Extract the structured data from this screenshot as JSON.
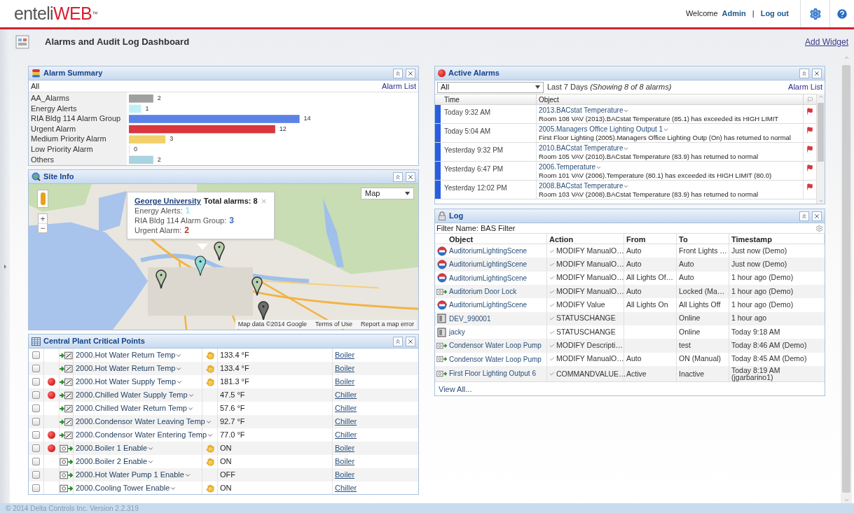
{
  "header": {
    "logo_main": "enteli",
    "logo_accent": "WEB",
    "logo_tm": "™",
    "welcome": "Welcome",
    "user": "Admin",
    "separator": "|",
    "logout": "Log out"
  },
  "page": {
    "title": "Alarms and Audit Log Dashboard",
    "add_widget": "Add Widget"
  },
  "alarm_summary": {
    "title": "Alarm Summary",
    "filter": "All",
    "link": "Alarm List",
    "chart_data": {
      "type": "bar",
      "orientation": "horizontal",
      "categories": [
        "AA_Alarms",
        "Energy Alerts",
        "RIA Bldg 114 Alarm Group",
        "Urgent Alarm",
        "Medium Priority Alarm",
        "Low Priority Alarm",
        "Others"
      ],
      "values": [
        2,
        1,
        14,
        12,
        3,
        0,
        2
      ],
      "colors": [
        "#a0a0a0",
        "#bff0f8",
        "#5b82e6",
        "#d9363e",
        "#f2d16b",
        "#dddddd",
        "#a9d3df"
      ],
      "data_labels": true
    }
  },
  "site_info": {
    "title": "Site Info",
    "map_type": "Map",
    "zoom_in": "+",
    "zoom_out": "−",
    "popup": {
      "site": "George University",
      "total": "Total alarms: 8",
      "lines": [
        {
          "label": "Energy Alerts:",
          "count": "1",
          "color": "#9ee3f0"
        },
        {
          "label": "RIA Bldg 114 Alarm Group:",
          "count": "3",
          "color": "#3b6fb6"
        },
        {
          "label": "Urgent Alarm:",
          "count": "2",
          "color": "#c0392b"
        }
      ]
    },
    "markers": [
      {
        "color": "#8fdada",
        "selected": true
      },
      {
        "color": "#b9cfae",
        "selected": false
      },
      {
        "color": "#b9cfae",
        "selected": false
      },
      {
        "color": "#b9cfae",
        "selected": false
      },
      {
        "color": "#6e6e6e",
        "selected": false
      }
    ],
    "attribution": "Map data ©2014 Google",
    "terms": "Terms of Use",
    "report": "Report a map error"
  },
  "central_plant": {
    "title": "Central Plant Critical Points",
    "rows": [
      {
        "checked": false,
        "alarm": false,
        "kind": "analog",
        "name": "2000.Hot Water Return Temp",
        "override": true,
        "value": "133.4 °F",
        "link": "Boiler"
      },
      {
        "checked": false,
        "alarm": false,
        "kind": "analog",
        "name": "2000.Hot Water Return Temp",
        "override": true,
        "value": "133.4 °F",
        "link": "Boiler"
      },
      {
        "checked": false,
        "alarm": true,
        "kind": "analog",
        "name": "2000.Hot Water Supply Temp",
        "override": true,
        "value": "181.3 °F",
        "link": "Boiler"
      },
      {
        "checked": false,
        "alarm": true,
        "kind": "analog",
        "name": "2000.Chilled Water Supply Temp",
        "override": false,
        "value": "47.5 °F",
        "link": "Chiller"
      },
      {
        "checked": false,
        "alarm": false,
        "kind": "analog",
        "name": "2000.Chilled Water Return Temp",
        "override": false,
        "value": "57.6 °F",
        "link": "Chiller"
      },
      {
        "checked": false,
        "alarm": false,
        "kind": "analog",
        "name": "2000.Condensor Water Leaving Temp",
        "override": false,
        "value": "92.7 °F",
        "link": "Chiller"
      },
      {
        "checked": false,
        "alarm": true,
        "kind": "analog",
        "name": "2000.Condensor Water Entering Temp",
        "override": false,
        "value": "77.0 °F",
        "link": "Chiller"
      },
      {
        "checked": false,
        "alarm": true,
        "kind": "binary",
        "name": "2000.Boiler 1 Enable",
        "override": true,
        "value": "ON",
        "link": "Boiler"
      },
      {
        "checked": false,
        "alarm": false,
        "kind": "binary",
        "name": "2000.Boiler 2 Enable",
        "override": true,
        "value": "ON",
        "link": "Boiler"
      },
      {
        "checked": false,
        "alarm": false,
        "kind": "binary",
        "name": "2000.Hot Water Pump 1 Enable",
        "override": false,
        "value": "OFF",
        "link": "Boiler"
      },
      {
        "checked": false,
        "alarm": false,
        "kind": "binary",
        "name": "2000.Cooling Tower Enable",
        "override": true,
        "value": "ON",
        "link": "Chiller"
      }
    ]
  },
  "active_alarms": {
    "title": "Active Alarms",
    "filter": "All",
    "range": "Last 7 Days *(Showing 8 of 8 alarms)*",
    "link": "Alarm List",
    "columns": [
      "Time",
      "Object"
    ],
    "rows": [
      {
        "time": "Today 9:32 AM",
        "object": "2013.BACstat Temperature",
        "message": "Room 108 VAV (2013).BACstat Temperature (85.1) has exceeded its HIGH LIMIT"
      },
      {
        "time": "Today 5:04 AM",
        "object": "2005.Managers Office Lighting Output 1",
        "message": "First Floor Lighting (2005).Managers Office Lighting Outp (On) has returned to normal"
      },
      {
        "time": "Yesterday 9:32 PM",
        "object": "2010.BACstat Temperature",
        "message": "Room 105 VAV (2010).BACstat Temperature (83.9) has returned to normal"
      },
      {
        "time": "Yesterday 6:47 PM",
        "object": "2006.Temperature",
        "message": "Room 101 VAV (2006).Temperature (80.1) has exceeded its HIGH LIMIT (80.0)"
      },
      {
        "time": "Yesterday 12:02 PM",
        "object": "2008.BACstat Temperature",
        "message": "Room 103 VAV (2008).BACstat Temperature (83.9) has returned to normal"
      }
    ]
  },
  "log": {
    "title": "Log",
    "filter": "Filter Name: BAS Filter",
    "columns": [
      "Object",
      "Action",
      "From",
      "To",
      "Timestamp"
    ],
    "rows": [
      {
        "kind": "scene",
        "object": "AuditoriumLightingScene",
        "action": "MODIFY ManualO…",
        "from": "Auto",
        "to": "Front Lights …",
        "timestamp": "Just now (Demo)"
      },
      {
        "kind": "scene",
        "object": "AuditoriumLightingScene",
        "action": "MODIFY ManualO…",
        "from": "Auto",
        "to": "Auto",
        "timestamp": "Just now (Demo)"
      },
      {
        "kind": "scene",
        "object": "AuditoriumLightingScene",
        "action": "MODIFY ManualO…",
        "from": "All Lights Of…",
        "to": "Auto",
        "timestamp": "1 hour ago (Demo)"
      },
      {
        "kind": "binary",
        "object": "Auditorium Door Lock",
        "action": "MODIFY ManualO…",
        "from": "Auto",
        "to": "Locked (Ma…",
        "timestamp": "1 hour ago (Demo)"
      },
      {
        "kind": "scene",
        "object": "AuditoriumLightingScene",
        "action": "MODIFY Value",
        "from": "All Lights On",
        "to": "All Lights Off",
        "timestamp": "1 hour ago (Demo)"
      },
      {
        "kind": "device",
        "object": "DEV_990001",
        "action": "STATUSCHANGE",
        "from": "",
        "to": "Online",
        "timestamp": "1 hour ago"
      },
      {
        "kind": "device",
        "object": "jacky",
        "action": "STATUSCHANGE",
        "from": "",
        "to": "Online",
        "timestamp": "Today 9:18 AM"
      },
      {
        "kind": "binary",
        "object": "Condensor Water Loop Pump",
        "action": "MODIFY Descripti…",
        "from": "",
        "to": "test",
        "timestamp": "Today 8:46 AM (Demo)"
      },
      {
        "kind": "binary",
        "object": "Condensor Water Loop Pump",
        "action": "MODIFY ManualO…",
        "from": "Auto",
        "to": "ON (Manual)",
        "timestamp": "Today 8:45 AM (Demo)"
      },
      {
        "kind": "binary",
        "object": "First Floor Lighting Output 6",
        "action": "COMMANDVALUE…",
        "from": "Active",
        "to": "Inactive",
        "timestamp": "Today 8:19 AM (jgarbarino1)"
      }
    ],
    "view_all": "View All..."
  },
  "footer": "© 2014 Delta Controls Inc. Version 2.2.319"
}
